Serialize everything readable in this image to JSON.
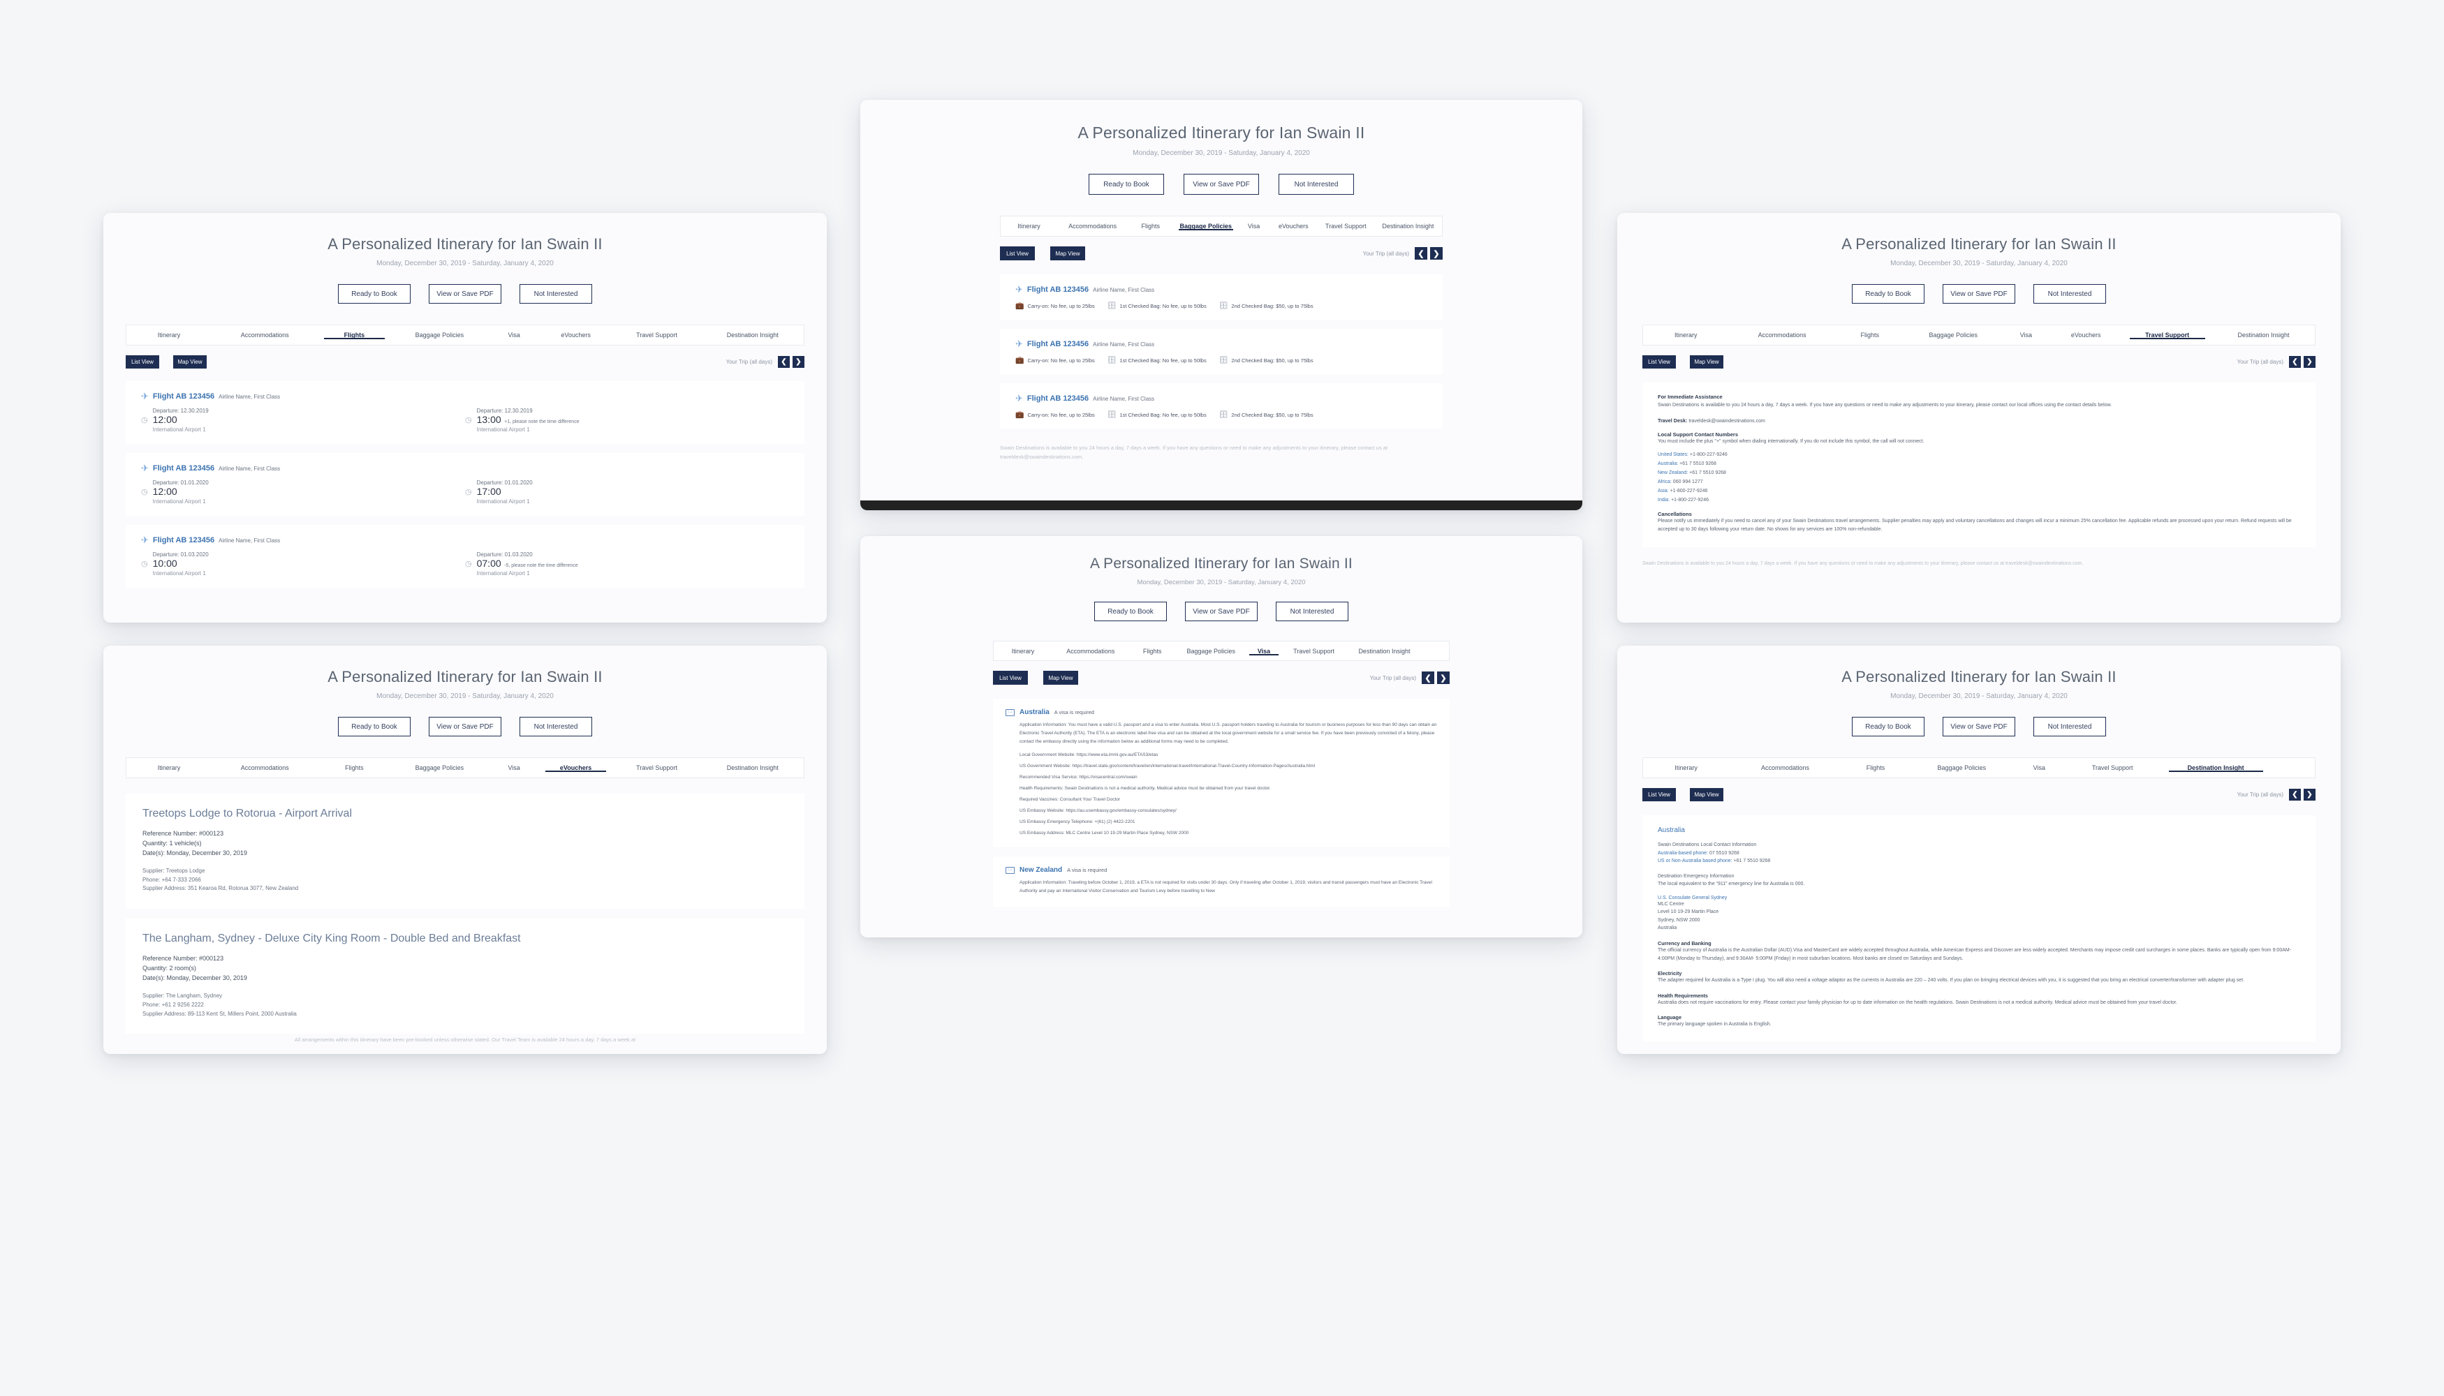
{
  "header": {
    "title": "A Personalized Itinerary for Ian Swain II",
    "dates": "Monday, December 30, 2019 - Saturday, January 4, 2020",
    "buttons": [
      "Ready to Book",
      "View or Save PDF",
      "Not Interested"
    ]
  },
  "tabs_full": [
    "Itinerary",
    "Accommodations",
    "Flights",
    "Baggage Policies",
    "Visa",
    "eVouchers",
    "Travel Support",
    "Destination Insight"
  ],
  "tabs_short": [
    "Itinerary",
    "Accommodations",
    "Flights",
    "Baggage Policies",
    "Visa",
    "Travel Support",
    "Destination Insight"
  ],
  "viewbar": {
    "list_view": "List View",
    "map_view": "Map View",
    "trip_label": "Your Trip (all days)",
    "prev_icon": "chevron-left-icon",
    "next_icon": "chevron-right-icon",
    "prev_glyph": "❮",
    "next_glyph": "❯"
  },
  "footers": {
    "swain": "Swain Destinations is available to you 24 hours a day, 7 days a week. If you have any questions or need to make any adjustments to your itinerary, please contact us at traveldesk@swaindestinations.com.",
    "prebooked": "All arrangements within this itinerary have been pre-booked unless otherwise stated. Our Travel Team is available 24 hours a day, 7 days a week at"
  },
  "cards": {
    "flights": {
      "active_tab": "Flights",
      "rows": [
        {
          "flight": "Flight AB 123456",
          "meta": "Airline Name, First Class",
          "depart": {
            "date": "Departure: 12.30.2019",
            "time": "12:00",
            "tz": "",
            "airport": "International Airport 1"
          },
          "arrive": {
            "date": "Departure: 12.30.2019",
            "time": "13:00",
            "tz": "+1, please note the time difference",
            "airport": "International Airport 1"
          }
        },
        {
          "flight": "Flight AB 123456",
          "meta": "Airline Name, First Class",
          "depart": {
            "date": "Departure: 01.01.2020",
            "time": "12:00",
            "tz": "",
            "airport": "International Airport 1"
          },
          "arrive": {
            "date": "Departure: 01.01.2020",
            "time": "17:00",
            "tz": "",
            "airport": "International Airport 1"
          }
        },
        {
          "flight": "Flight AB 123456",
          "meta": "Airline Name, First Class",
          "depart": {
            "date": "Departure: 01.03.2020",
            "time": "10:00",
            "tz": "",
            "airport": "International Airport 1"
          },
          "arrive": {
            "date": "Departure: 01.03.2020",
            "time": "07:00",
            "tz": "-5, please note the time difference",
            "airport": "International Airport 1"
          }
        }
      ]
    },
    "baggage": {
      "active_tab": "Baggage Policies",
      "rows": [
        {
          "flight": "Flight AB 123456",
          "meta": "Airline Name, First Class",
          "bags": [
            "Carry-on: No fee, up to 25lbs",
            "1st Checked Bag: No fee, up to 50lbs",
            "2nd Checked Bag: $50, up to 75lbs"
          ]
        },
        {
          "flight": "Flight AB 123456",
          "meta": "Airline Name, First Class",
          "bags": [
            "Carry-on: No fee, up to 25lbs",
            "1st Checked Bag: No fee, up to 50lbs",
            "2nd Checked Bag: $50, up to 75lbs"
          ]
        },
        {
          "flight": "Flight AB 123456",
          "meta": "Airline Name, First Class",
          "bags": [
            "Carry-on: No fee, up to 25lbs",
            "1st Checked Bag: No fee, up to 50lbs",
            "2nd Checked Bag: $50, up to 75lbs"
          ]
        }
      ]
    },
    "evouchers": {
      "active_tab": "eVouchers",
      "items": [
        {
          "title": "Treetops Lodge to Rotorua - Airport Arrival",
          "reference": "Reference Number: #000123",
          "quantity": "Quantity: 1 vehicle(s)",
          "dates": "Date(s): Monday, December 30, 2019",
          "supplier": "Supplier: Treetops Lodge",
          "phone": "Phone: +64 7-333 2066",
          "address": "Supplier Address: 351 Kearoa Rd, Rotorua 3077, New Zealand"
        },
        {
          "title": "The Langham, Sydney - Deluxe City King Room - Double Bed and Breakfast",
          "reference": "Reference Number: #000123",
          "quantity": "Quantity: 2 room(s)",
          "dates": "Date(s): Monday, December 30, 2019",
          "supplier": "Supplier: The Langham, Sydney",
          "phone": "Phone: +61 2 9256 2222",
          "address": "Supplier Address: 89-113 Kent St, Millers Point, 2000 Australia"
        }
      ]
    },
    "visa": {
      "active_tab": "Visa",
      "entries": [
        {
          "country": "Australia",
          "requirement": "A visa is required",
          "icon": "passport-icon",
          "lines": [
            "Application Information: You must have a valid U.S. passport and a visa to enter Australia. Most U.S. passport holders traveling to Australia for tourism or business purposes for less than 90 days can obtain an Electronic Travel Authority (ETA). The ETA is an electronic label-free visa and can be obtained at the local government website for a small service fee. If you have been previously convicted of a felony, please contact the embassy directly using the information below as additional forms may need to be completed.",
            "Local Government Website: https://www.eta.immi.gov.au/ETAS3/etas",
            "US Government Website: https://travel.state.gov/content/travel/en/international-travel/International-Travel-Country-Information-Pages/Australia.html",
            "Recommended Visa Service: https://visacentral.com/swain",
            "Health Requirements: Swain Destinations is not a medical authority. Medical advice must be obtained from your travel doctor.",
            "Required Vaccines: Consultant Your Travel Doctor",
            "US Embassy Website: https://au.usembassy.gov/embassy-consulates/sydney/",
            "US Embassy Emergency Telephone: +(61) (2) 4422-2201",
            "US Embassy Address: MLC Centre Level 10 19-29 Martin Place Sydney, NSW 2000"
          ]
        },
        {
          "country": "New Zealand",
          "requirement": "A visa is required",
          "icon": "passport-icon",
          "lines": [
            "Application Information:  Traveling before October 1, 2019, a ETA is not required for visits under 30 days. Only if traveling after October 1, 2019, visitors and transit passengers must have an Electronic Travel Authority and pay an International Visitor Conservation and Tourism Levy before travelling to New"
          ]
        }
      ]
    },
    "support": {
      "active_tab": "Travel Support",
      "sections": [
        {
          "title": "For Immediate Assistance",
          "body": "Swain Destinations is available to you 24 hours a day, 7 days a week. If you have any questions or need to make any adjustments to your itinerary, please contact our local offices using the contact details below."
        }
      ],
      "travel_desk_label": "Travel Desk:",
      "travel_desk_value": "traveldesk@swaindestinations.com",
      "contacts_title": "Local Support Contact Numbers",
      "contacts_note": "You must include the plus \"+\" symbol when dialing internationally. If you do not include this symbol, the call will not connect.",
      "contacts": [
        {
          "region": "United States:",
          "number": "+1-800-227-9246"
        },
        {
          "region": "Australia:",
          "number": "+61 7 5510 9268"
        },
        {
          "region": "New Zealand:",
          "number": "+61 7 5510 9268"
        },
        {
          "region": "Africa:",
          "number": "060 994 1277"
        },
        {
          "region": "Asia:",
          "number": "+1-800-227-9246"
        },
        {
          "region": "India:",
          "number": "+1-800-227-9246"
        }
      ],
      "cancel_title": "Cancellations",
      "cancel_body": "Please notify us immediately if you need to cancel any of your Swain Destinations travel arrangements. Supplier penalties may apply and voluntary cancellations and changes will incur a minimum 25% cancellation fee. Applicable refunds are processed upon your return. Refund requests will be accepted up to 30 days following your return date. No shows for any services are 100% non-refundable."
    },
    "insight": {
      "active_tab": "Destination Insight",
      "country": "Australia",
      "contact_title": "Swain Destinations Local Contact Information",
      "contact_lines": [
        {
          "label": "Australia-based phone:",
          "value": "07 5510 9268"
        },
        {
          "label": "US or Non-Australia based phone:",
          "value": "+61 7 5510 9268"
        }
      ],
      "emergency_title": "Destination Emergency Information",
      "emergency_body": "The local equivalent to the “911” emergency line for Australia is 000.",
      "consulate_title": "U.S. Consulate General Sydney",
      "consulate_lines": [
        "MLC Centre",
        "Level 10 19-29 Martin Place",
        "Sydney, NSW 2000",
        "Australia"
      ],
      "sections": [
        {
          "title": "Currency and Banking",
          "body": "The official currency of Australia is the Australian Dollar (AUD).Visa and MasterCard are widely accepted throughout Australia, while American Express and Discover are less widely accepted. Merchants may impose credit card surcharges in some places. Banks are typically open from 9:00AM- 4:00PM (Monday to Thursday), and 9:30AM- 5:00PM (Friday) in most suburban locations. Most banks are closed on Saturdays and Sundays."
        },
        {
          "title": "Electricity",
          "body": "The adapter required for Australia is a Type I plug. You will also need a voltage adaptor as the currents in Australia are 220 – 240 volts. If you plan on bringing electrical devices with you, it is suggested that you bring an electrical converter/transformer with adapter plug set."
        },
        {
          "title": "Health Requirements",
          "body": "Australia does not require vaccinations for entry. Please contact your family physician for up to date information on the health regulations. Swain Destinations is not a medical authority. Medical advice must be obtained from your travel doctor."
        },
        {
          "title": "Language",
          "body": "The primary language spoken in Australia is English."
        }
      ]
    }
  },
  "colors": {
    "navy": "#1e2d52",
    "link_blue": "#3b73b0",
    "page_bg": "#f4f6f8",
    "card_bg": "#fbfbfd"
  }
}
